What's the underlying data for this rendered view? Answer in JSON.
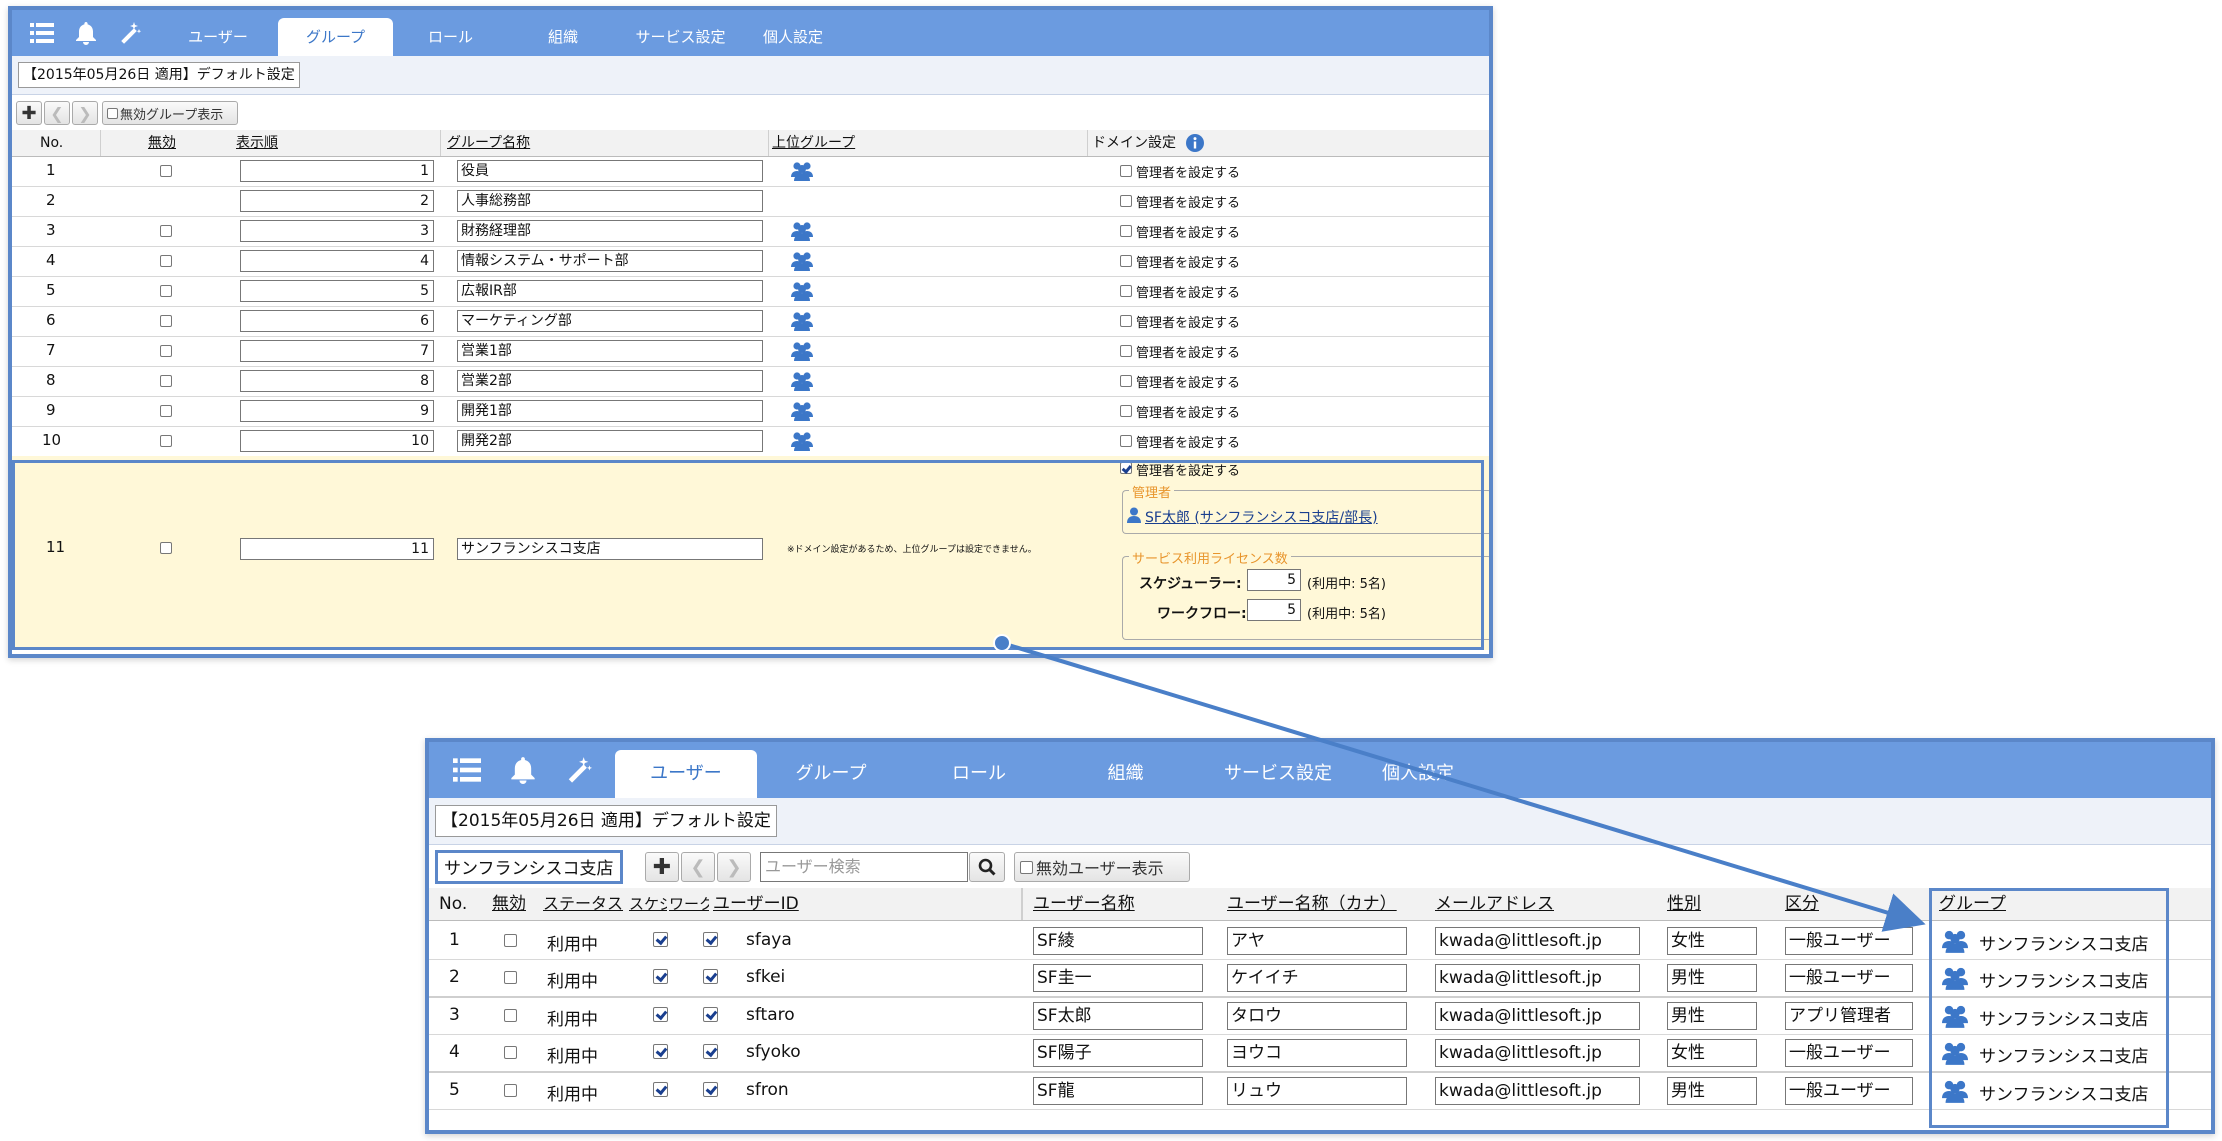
{
  "top": {
    "nav": {
      "icons": [
        "list-icon",
        "bell-icon",
        "magic-wand-icon"
      ],
      "tabs": [
        {
          "label": "ユーザー",
          "active": false
        },
        {
          "label": "グループ",
          "active": true
        },
        {
          "label": "ロール",
          "active": false
        },
        {
          "label": "組織",
          "active": false
        },
        {
          "label": "サービス設定",
          "active": false
        },
        {
          "label": "個人設定",
          "active": false
        }
      ]
    },
    "setting": "【2015年05月26日 適用】デフォルト設定",
    "toolbar": {
      "show_disabled": "無効グループ表示"
    },
    "headers": {
      "no": "No.",
      "disabled": "無効",
      "order": "表示順",
      "name": "グループ名称",
      "parent": "上位グループ",
      "domain": "ドメイン設定"
    },
    "rows": [
      {
        "no": "1",
        "order": "1",
        "name": "役員",
        "parent": true,
        "has_disabled": true,
        "admin": "管理者を設定する"
      },
      {
        "no": "2",
        "order": "2",
        "name": "人事総務部",
        "parent": false,
        "has_disabled": false,
        "admin": "管理者を設定する"
      },
      {
        "no": "3",
        "order": "3",
        "name": "財務経理部",
        "parent": true,
        "has_disabled": true,
        "admin": "管理者を設定する"
      },
      {
        "no": "4",
        "order": "4",
        "name": "情報システム・サポート部",
        "parent": true,
        "has_disabled": true,
        "admin": "管理者を設定する"
      },
      {
        "no": "5",
        "order": "5",
        "name": "広報IR部",
        "parent": true,
        "has_disabled": true,
        "admin": "管理者を設定する"
      },
      {
        "no": "6",
        "order": "6",
        "name": "マーケティング部",
        "parent": true,
        "has_disabled": true,
        "admin": "管理者を設定する"
      },
      {
        "no": "7",
        "order": "7",
        "name": "営業1部",
        "parent": true,
        "has_disabled": true,
        "admin": "管理者を設定する"
      },
      {
        "no": "8",
        "order": "8",
        "name": "営業2部",
        "parent": true,
        "has_disabled": true,
        "admin": "管理者を設定する"
      },
      {
        "no": "9",
        "order": "9",
        "name": "開発1部",
        "parent": true,
        "has_disabled": true,
        "admin": "管理者を設定する"
      },
      {
        "no": "10",
        "order": "10",
        "name": "開発2部",
        "parent": true,
        "has_disabled": true,
        "admin": "管理者を設定する"
      }
    ],
    "row11": {
      "no": "11",
      "order": "11",
      "name": "サンフランシスコ支店",
      "note": "※ドメイン設定があるため、上位グループは設定できません。",
      "admin_check": "管理者を設定する",
      "admin_legend": "管理者",
      "admin_user": "SF太郎 (サンフランシスコ支店/部長)",
      "license_legend": "サービス利用ライセンス数",
      "licenses": [
        {
          "label": "スケジューラー:",
          "value": "5",
          "usage": "(利用中: 5名)"
        },
        {
          "label": "ワークフロー:",
          "value": "5",
          "usage": "(利用中: 5名)"
        }
      ]
    }
  },
  "bottom": {
    "nav": {
      "icons": [
        "list-icon",
        "bell-icon",
        "magic-wand-icon"
      ],
      "tabs": [
        {
          "label": "ユーザー",
          "active": true
        },
        {
          "label": "グループ",
          "active": false
        },
        {
          "label": "ロール",
          "active": false
        },
        {
          "label": "組織",
          "active": false
        },
        {
          "label": "サービス設定",
          "active": false
        },
        {
          "label": "個人設定",
          "active": false
        }
      ]
    },
    "setting": "【2015年05月26日 適用】デフォルト設定",
    "group_select": "サンフランシスコ支店",
    "search_placeholder": "ユーザー検索",
    "show_disabled": "無効ユーザー表示",
    "headers": {
      "no": "No.",
      "disabled": "無効",
      "status": "ステータス",
      "sched": "スケジ",
      "work": "ワークフ",
      "uid": "ユーザーID",
      "name": "ユーザー名称",
      "kana": "ユーザー名称（カナ）",
      "mail": "メールアドレス",
      "sex": "性別",
      "type": "区分",
      "group": "グループ"
    },
    "rows": [
      {
        "no": "1",
        "status": "利用中",
        "uid": "sfaya",
        "name": "SF綾",
        "kana": "アヤ",
        "mail": "kwada@littlesoft.jp",
        "sex": "女性",
        "type": "一般ユーザー",
        "group": "サンフランシスコ支店"
      },
      {
        "no": "2",
        "status": "利用中",
        "uid": "sfkei",
        "name": "SF圭一",
        "kana": "ケイイチ",
        "mail": "kwada@littlesoft.jp",
        "sex": "男性",
        "type": "一般ユーザー",
        "group": "サンフランシスコ支店"
      },
      {
        "no": "3",
        "status": "利用中",
        "uid": "sftaro",
        "name": "SF太郎",
        "kana": "タロウ",
        "mail": "kwada@littlesoft.jp",
        "sex": "男性",
        "type": "アプリ管理者",
        "group": "サンフランシスコ支店"
      },
      {
        "no": "4",
        "status": "利用中",
        "uid": "sfyoko",
        "name": "SF陽子",
        "kana": "ヨウコ",
        "mail": "kwada@littlesoft.jp",
        "sex": "女性",
        "type": "一般ユーザー",
        "group": "サンフランシスコ支店"
      },
      {
        "no": "5",
        "status": "利用中",
        "uid": "sfron",
        "name": "SF龍",
        "kana": "リュウ",
        "mail": "kwada@littlesoft.jp",
        "sex": "男性",
        "type": "一般ユーザー",
        "group": "サンフランシスコ支店"
      }
    ]
  },
  "colors": {
    "nav": "#6b9be0",
    "accent": "#5b87c9",
    "highlight_row": "#fff8d8",
    "legend": "#e8952c",
    "link": "#1a3f8f"
  }
}
